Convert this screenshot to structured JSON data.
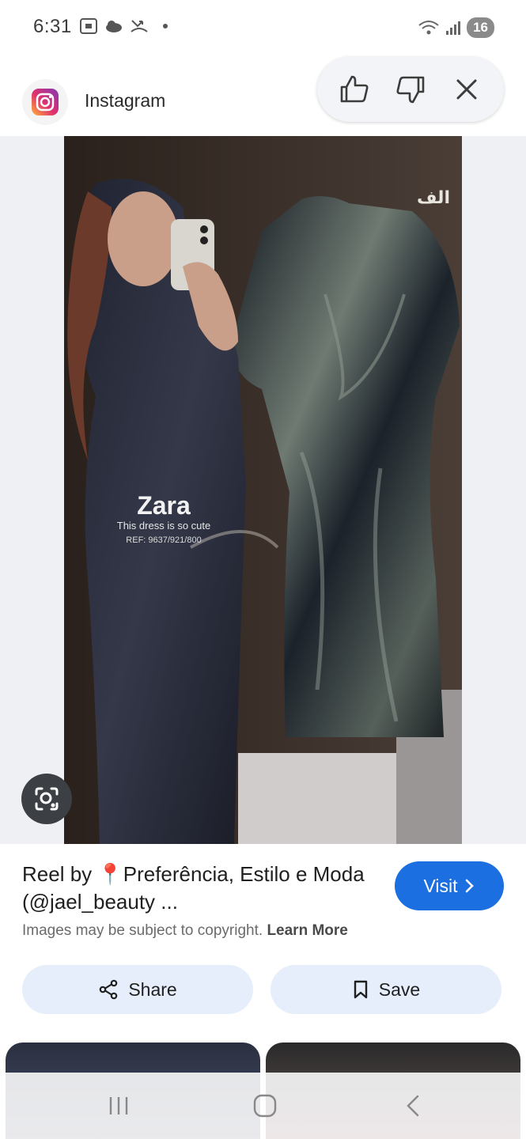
{
  "status_bar": {
    "time": "6:31",
    "battery": "16"
  },
  "header": {
    "app_name": "Instagram",
    "icons": [
      "instagram-logo",
      "thumbs-up-icon",
      "thumbs-down-icon",
      "close-icon"
    ]
  },
  "image": {
    "overlay_brand": "Zara",
    "overlay_caption": "This dress is so cute",
    "overlay_ref": "REF: 9637/921/800",
    "overlay_arabic": "الف"
  },
  "result": {
    "title": "Reel by 📍Preferência, Estilo e Moda (@jael_beauty ...",
    "visit_label": "Visit",
    "copyright_text": "Images may be subject to copyright.",
    "learn_more": "Learn More"
  },
  "actions": {
    "share_label": "Share",
    "save_label": "Save"
  },
  "colors": {
    "accent": "#1b6fe0",
    "action_bg": "#e6eefb",
    "image_bg": "#eef0f3"
  }
}
